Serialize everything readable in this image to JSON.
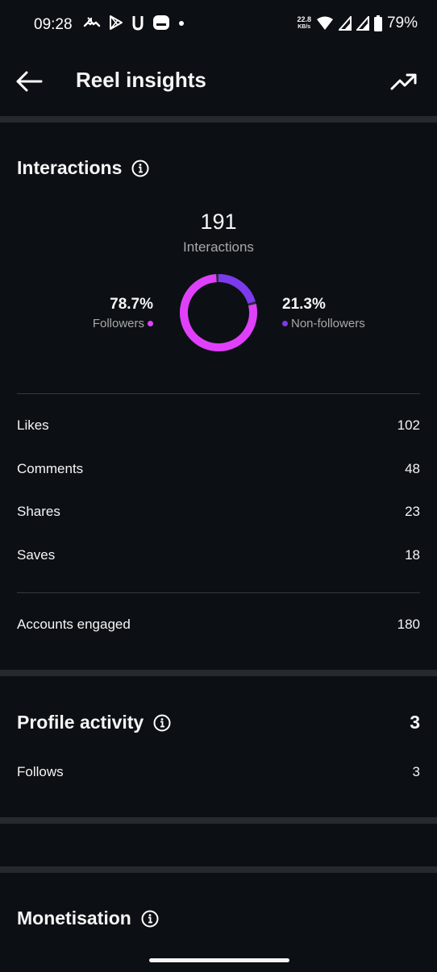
{
  "status_bar": {
    "time": "09:28",
    "net_speed_value": "22.8",
    "net_speed_unit": "KB/s",
    "battery": "79%"
  },
  "header": {
    "title": "Reel insights"
  },
  "interactions": {
    "title": "Interactions",
    "total": "191",
    "total_label": "Interactions",
    "followers_pct": "78.7%",
    "followers_label": "Followers",
    "non_followers_pct": "21.3%",
    "non_followers_label": "Non-followers",
    "followers_fraction": 0.787,
    "non_followers_fraction": 0.213,
    "followers_color": "#e040fb",
    "non_followers_color": "#7c3aed",
    "rows": [
      {
        "label": "Likes",
        "value": "102"
      },
      {
        "label": "Comments",
        "value": "48"
      },
      {
        "label": "Shares",
        "value": "23"
      },
      {
        "label": "Saves",
        "value": "18"
      }
    ],
    "accounts_engaged_label": "Accounts engaged",
    "accounts_engaged_value": "180"
  },
  "profile_activity": {
    "title": "Profile activity",
    "total": "3",
    "follows_label": "Follows",
    "follows_value": "3"
  },
  "monetisation": {
    "title": "Monetisation"
  }
}
